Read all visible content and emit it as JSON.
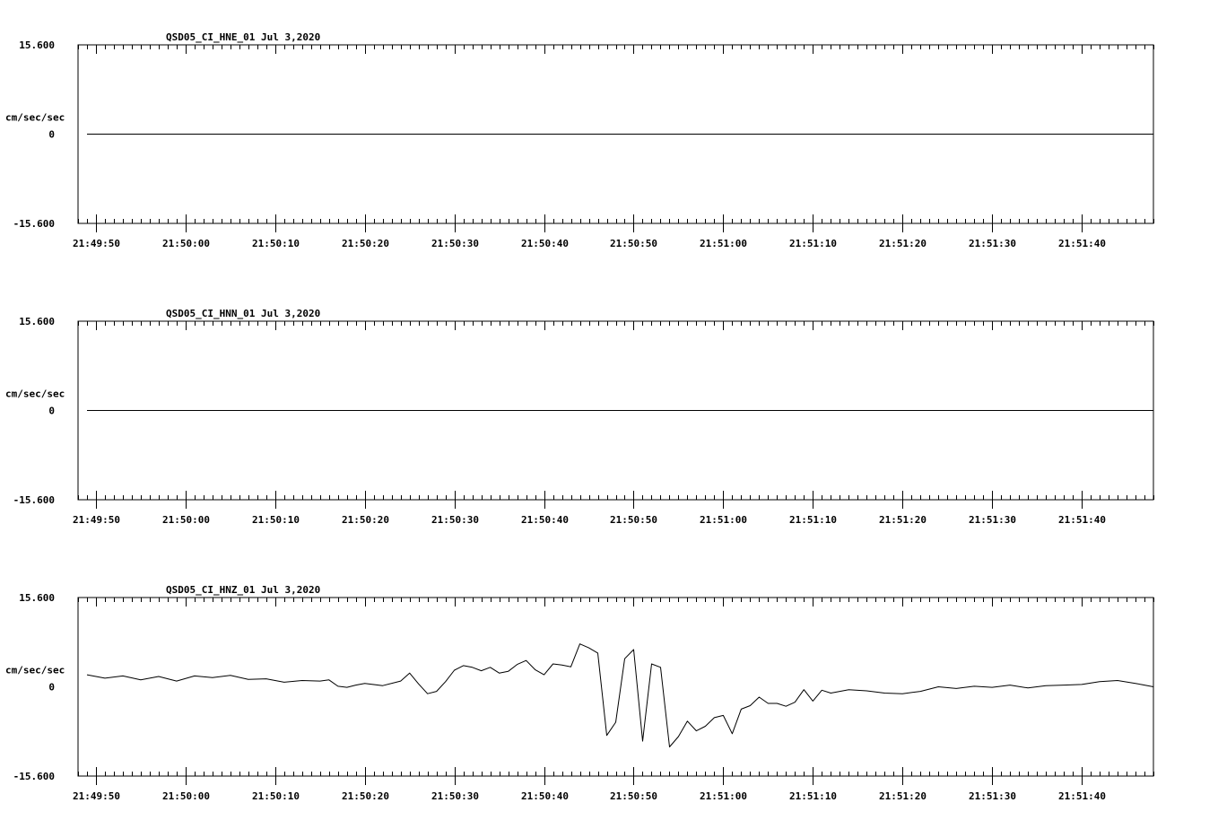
{
  "chart_data": [
    {
      "type": "line",
      "title": "QSD05_CI_HNE_01  Jul 3,2020",
      "ylabel": "cm/sec/sec",
      "ylim": [
        -15.6,
        15.6
      ],
      "y_tick_labels": [
        "15.600",
        "0",
        "-15.600"
      ],
      "xlim": [
        "21:49:48",
        "21:51:48"
      ],
      "x_tick_labels": [
        "21:49:50",
        "21:50:00",
        "21:50:10",
        "21:50:20",
        "21:50:30",
        "21:50:40",
        "21:50:50",
        "21:51:00",
        "21:51:10",
        "21:51:20",
        "21:51:30",
        "21:51:40"
      ],
      "series": [
        {
          "x": [
            "21:49:49",
            "21:50:00",
            "21:50:10",
            "21:50:20",
            "21:50:30",
            "21:50:40",
            "21:50:50",
            "21:51:00",
            "21:51:10",
            "21:51:20",
            "21:51:30",
            "21:51:40",
            "21:51:48"
          ],
          "values": [
            0,
            0,
            0,
            0,
            0,
            0,
            0,
            0,
            0,
            0,
            0,
            0,
            0
          ]
        }
      ]
    },
    {
      "type": "line",
      "title": "QSD05_CI_HNN_01  Jul 3,2020",
      "ylabel": "cm/sec/sec",
      "ylim": [
        -15.6,
        15.6
      ],
      "y_tick_labels": [
        "15.600",
        "0",
        "-15.600"
      ],
      "xlim": [
        "21:49:48",
        "21:51:48"
      ],
      "x_tick_labels": [
        "21:49:50",
        "21:50:00",
        "21:50:10",
        "21:50:20",
        "21:50:30",
        "21:50:40",
        "21:50:50",
        "21:51:00",
        "21:51:10",
        "21:51:20",
        "21:51:30",
        "21:51:40"
      ],
      "series": [
        {
          "x": [
            "21:49:49",
            "21:50:00",
            "21:50:10",
            "21:50:20",
            "21:50:30",
            "21:50:40",
            "21:50:50",
            "21:51:00",
            "21:51:10",
            "21:51:20",
            "21:51:30",
            "21:51:40",
            "21:51:48"
          ],
          "values": [
            0,
            0,
            0,
            0,
            0,
            0,
            0,
            0,
            0,
            0,
            0,
            0,
            0
          ]
        }
      ]
    },
    {
      "type": "line",
      "title": "QSD05_CI_HNZ_01  Jul 3,2020",
      "ylabel": "cm/sec/sec",
      "ylim": [
        -15.6,
        15.6
      ],
      "y_tick_labels": [
        "15.600",
        "0",
        "-15.600"
      ],
      "xlim": [
        "21:49:48",
        "21:51:48"
      ],
      "x_tick_labels": [
        "21:49:50",
        "21:50:00",
        "21:50:10",
        "21:50:20",
        "21:50:30",
        "21:50:40",
        "21:50:50",
        "21:51:00",
        "21:51:10",
        "21:51:20",
        "21:51:30",
        "21:51:40"
      ],
      "series": [
        {
          "x": [
            "21:49:49",
            "21:49:51",
            "21:49:53",
            "21:49:55",
            "21:49:57",
            "21:49:59",
            "21:50:01",
            "21:50:03",
            "21:50:05",
            "21:50:07",
            "21:50:09",
            "21:50:11",
            "21:50:13",
            "21:50:15",
            "21:50:16",
            "21:50:17",
            "21:50:18",
            "21:50:19",
            "21:50:20",
            "21:50:22",
            "21:50:24",
            "21:50:25",
            "21:50:26",
            "21:50:27",
            "21:50:28",
            "21:50:29",
            "21:50:30",
            "21:50:31",
            "21:50:32",
            "21:50:33",
            "21:50:34",
            "21:50:35",
            "21:50:36",
            "21:50:37",
            "21:50:38",
            "21:50:39",
            "21:50:40",
            "21:50:41",
            "21:50:42",
            "21:50:43",
            "21:50:44",
            "21:50:45",
            "21:50:46",
            "21:50:47",
            "21:50:48",
            "21:50:49",
            "21:50:50",
            "21:50:51",
            "21:50:52",
            "21:50:53",
            "21:50:54",
            "21:50:55",
            "21:50:56",
            "21:50:57",
            "21:50:58",
            "21:50:59",
            "21:51:00",
            "21:51:01",
            "21:51:02",
            "21:51:03",
            "21:51:04",
            "21:51:05",
            "21:51:06",
            "21:51:07",
            "21:51:08",
            "21:51:09",
            "21:51:10",
            "21:51:11",
            "21:51:12",
            "21:51:14",
            "21:51:16",
            "21:51:18",
            "21:51:20",
            "21:51:22",
            "21:51:24",
            "21:51:26",
            "21:51:28",
            "21:51:30",
            "21:51:32",
            "21:51:34",
            "21:51:36",
            "21:51:38",
            "21:51:40",
            "21:51:42",
            "21:51:44",
            "21:51:46",
            "21:51:48"
          ],
          "values": [
            2.1,
            1.5,
            1.9,
            1.2,
            1.8,
            1.0,
            1.9,
            1.6,
            2.0,
            1.3,
            1.4,
            0.8,
            1.1,
            1.0,
            1.2,
            0.1,
            -0.1,
            0.3,
            0.6,
            0.2,
            1.0,
            2.4,
            0.5,
            -1.2,
            -0.8,
            0.9,
            2.9,
            3.7,
            3.4,
            2.8,
            3.4,
            2.4,
            2.7,
            3.9,
            4.6,
            3.0,
            2.1,
            4.0,
            3.8,
            3.5,
            7.5,
            6.8,
            5.9,
            -8.5,
            -6.2,
            4.9,
            6.5,
            -9.5,
            4.0,
            3.4,
            -10.5,
            -8.7,
            -6.0,
            -7.7,
            -6.9,
            -5.4,
            -5.0,
            -8.2,
            -3.9,
            -3.3,
            -1.8,
            -2.9,
            -2.9,
            -3.4,
            -2.7,
            -0.5,
            -2.5,
            -0.6,
            -1.1,
            -0.5,
            -0.7,
            -1.1,
            -1.2,
            -0.8,
            0.0,
            -0.3,
            0.1,
            -0.1,
            0.3,
            -0.2,
            0.2,
            0.3,
            0.4,
            0.9,
            1.1,
            0.6,
            0.0
          ]
        }
      ]
    }
  ]
}
